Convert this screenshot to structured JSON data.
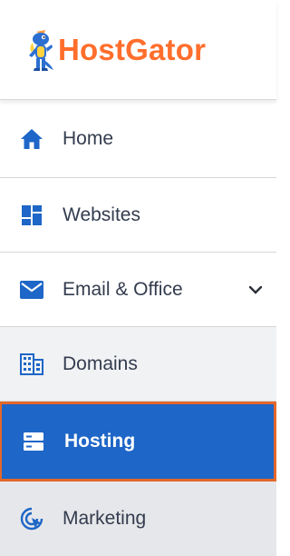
{
  "brand": {
    "name": "HostGator",
    "color": "#ff6e2c"
  },
  "nav": {
    "items": [
      {
        "label": "Home",
        "icon": "home-icon"
      },
      {
        "label": "Websites",
        "icon": "dashboard-grid-icon"
      },
      {
        "label": "Email & Office",
        "icon": "mail-icon",
        "expandable": true
      },
      {
        "label": "Domains",
        "icon": "building-grid-icon"
      },
      {
        "label": "Hosting",
        "icon": "server-icon",
        "active": true
      },
      {
        "label": "Marketing",
        "icon": "target-cursor-icon"
      }
    ]
  },
  "colors": {
    "accent": "#1e66c7",
    "active_border": "#e2672a",
    "text": "#333c4e"
  }
}
